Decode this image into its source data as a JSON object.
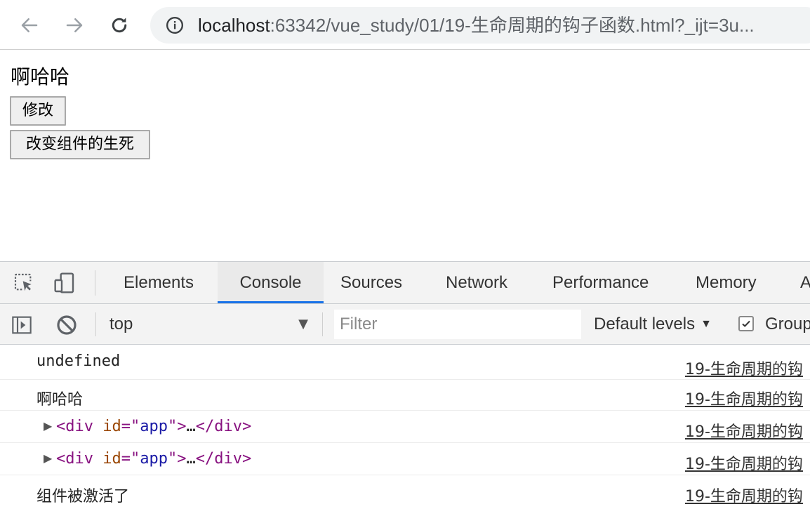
{
  "browser": {
    "url_host": "localhost",
    "url_rest": ":63342/vue_study/01/19-生命周期的钩子函数.html?_ijt=3u..."
  },
  "page": {
    "text": "啊哈哈",
    "buttons": [
      "修改",
      "改变组件的生死"
    ]
  },
  "devtools": {
    "tabs": [
      "Elements",
      "Console",
      "Sources",
      "Network",
      "Performance",
      "Memory",
      "A"
    ],
    "active_tab": "Console",
    "context": "top",
    "filter_placeholder": "Filter",
    "levels": "Default levels",
    "group_label": "Group",
    "group_checked": true,
    "accent": "#1a73e8"
  },
  "console": {
    "source": "19-生命周期的钩",
    "messages": [
      {
        "kind": "undefined",
        "text": "undefined"
      },
      {
        "kind": "text",
        "text": "啊哈哈"
      },
      {
        "kind": "element",
        "tag": "div",
        "attr": "id",
        "value": "app",
        "ellipsis": "…"
      },
      {
        "kind": "element",
        "tag": "div",
        "attr": "id",
        "value": "app",
        "ellipsis": "…"
      },
      {
        "kind": "text",
        "text": "组件被激活了"
      }
    ]
  }
}
